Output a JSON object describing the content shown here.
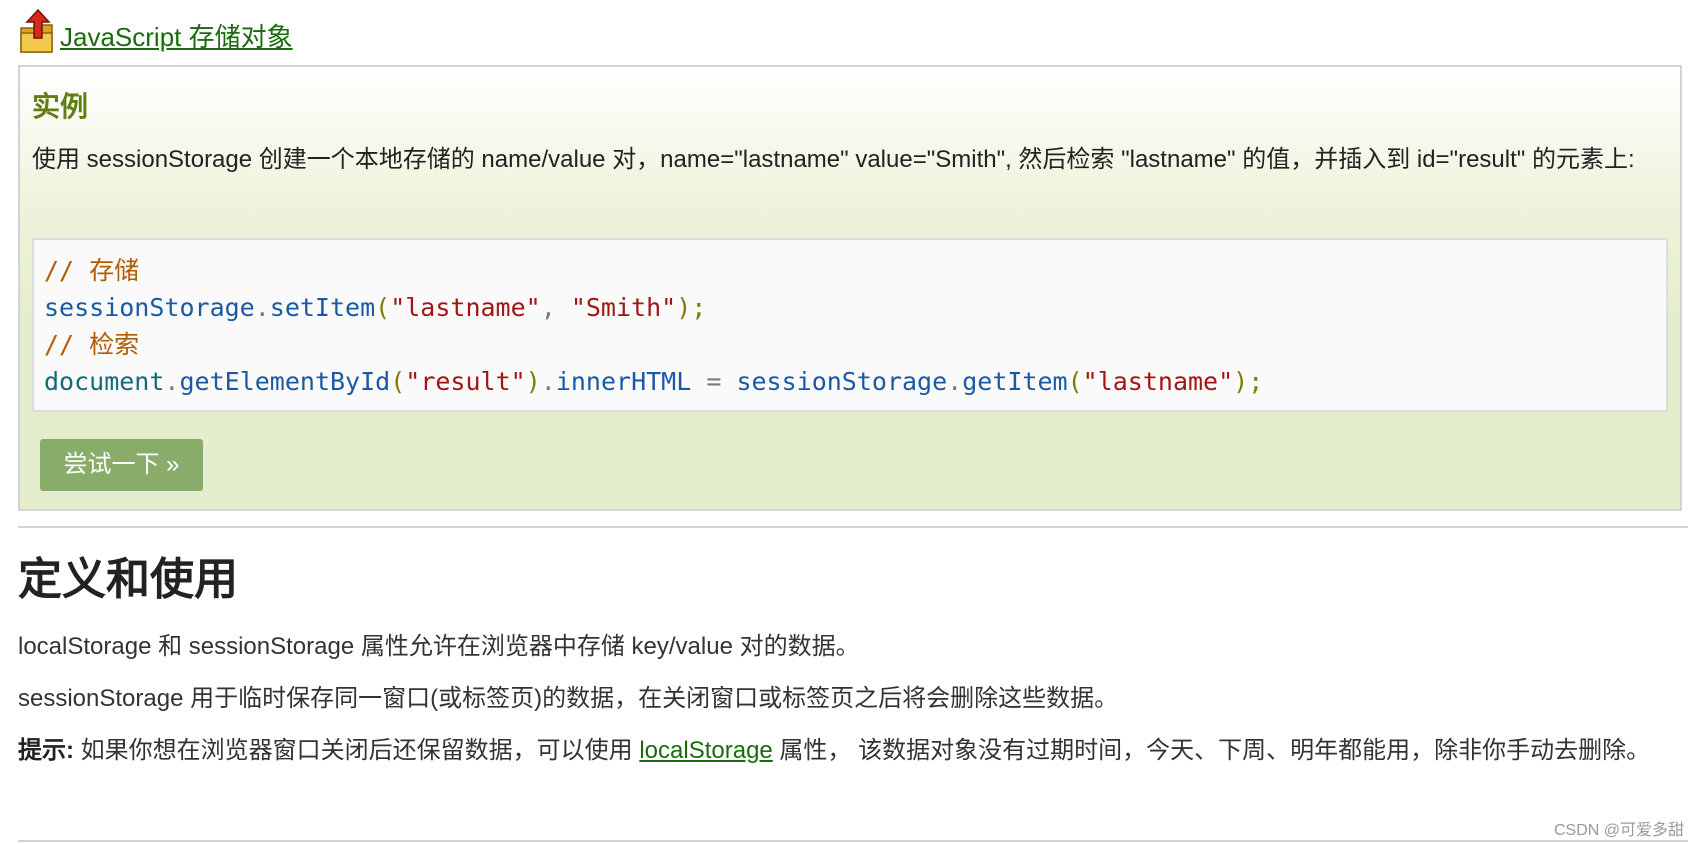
{
  "back_link": {
    "icon": "back-arrow-folder-icon",
    "label": "JavaScript 存储对象"
  },
  "example": {
    "title": "实例",
    "description": "使用 sessionStorage 创建一个本地存储的 name/value 对，name=\"lastname\" value=\"Smith\", 然后检索 \"lastname\" 的值，并插入到 id=\"result\" 的元素上:",
    "code": {
      "comment_store": "// 存储",
      "line2": {
        "obj": "sessionStorage",
        "dot": ".",
        "method": "setItem",
        "open": "(",
        "arg1": "\"lastname\"",
        "comma": ", ",
        "arg2": "\"Smith\"",
        "close": ");"
      },
      "comment_retrieve": "// 检索",
      "line4": {
        "doc": "document",
        "dot1": ".",
        "method1": "getElementById",
        "open1": "(",
        "arg1": "\"result\"",
        "close1": ")",
        "dot2": ".",
        "prop": "innerHTML",
        "eq": " = ",
        "obj": "sessionStorage",
        "dot3": ".",
        "method2": "getItem",
        "open2": "(",
        "arg2": "\"lastname\"",
        "close2": ");"
      }
    },
    "try_button": "尝试一下 »"
  },
  "section": {
    "title": "定义和使用",
    "para1": "localStorage 和 sessionStorage 属性允许在浏览器中存储 key/value 对的数据。",
    "para2": "sessionStorage 用于临时保存同一窗口(或标签页)的数据，在关闭窗口或标签页之后将会删除这些数据。",
    "tip_label": "提示:",
    "tip_before": " 如果你想在浏览器窗口关闭后还保留数据，可以使用 ",
    "tip_link": "localStorage",
    "tip_after": " 属性， 该数据对象没有过期时间，今天、下周、明年都能用，除非你手动去删除。"
  },
  "watermark": "CSDN @可爱多甜",
  "colors": {
    "link": "#1a6b0e",
    "example_title": "#617f10",
    "example_bg": "#e5eecc",
    "button_bg": "#8aac6a"
  }
}
